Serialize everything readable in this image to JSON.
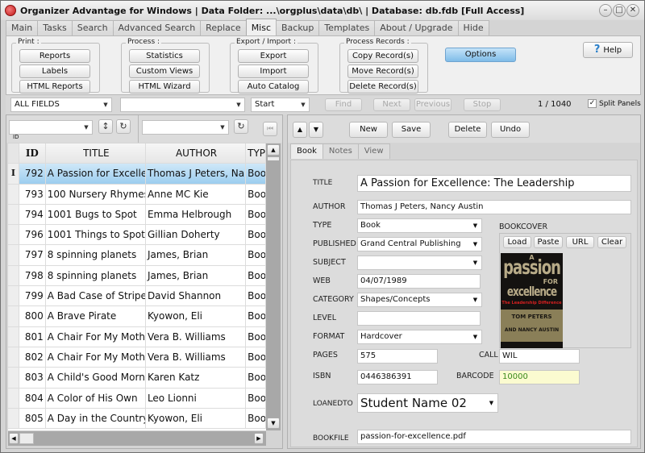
{
  "window": {
    "title": "Organizer Advantage for Windows | Data Folder: ...\\orgplus\\data\\db\\ | Database: db.fdb [Full Access]",
    "controls": [
      "–",
      "□",
      "✕"
    ]
  },
  "tabs": [
    "Main",
    "Tasks",
    "Search",
    "Advanced Search",
    "Replace",
    "Misc",
    "Backup",
    "Templates",
    "About / Upgrade",
    "Hide"
  ],
  "active_tab": "Misc",
  "ribbon": {
    "print": {
      "label": "Print :",
      "buttons": [
        "Reports",
        "Labels",
        "HTML Reports"
      ]
    },
    "process": {
      "label": "Process :",
      "buttons": [
        "Statistics",
        "Custom Views",
        "HTML Wizard"
      ]
    },
    "export": {
      "label": "Export / Import :",
      "buttons": [
        "Export",
        "Import",
        "Auto Catalog"
      ]
    },
    "records": {
      "label": "Process Records :",
      "buttons": [
        "Copy Record(s)",
        "Move Record(s)",
        "Delete Record(s)"
      ]
    },
    "options_label": "Options",
    "help_label": "Help",
    "help_icon": "?"
  },
  "search": {
    "field": "ALL FIELDS",
    "value": "",
    "mode": "Start",
    "find": "Find",
    "next": "Next",
    "previous": "Previous",
    "stop": "Stop",
    "record_count": "1 / 1040",
    "split_panels": "Split Panels",
    "split_checked": "✓"
  },
  "filter": {
    "sort_field": "",
    "sort_label": "ID",
    "filter_field": ""
  },
  "grid": {
    "columns": [
      "ID",
      "TITLE",
      "AUTHOR",
      "TYPE"
    ],
    "selected_indicator": "I",
    "rows": [
      {
        "id": "792",
        "title": "A Passion for Excelle",
        "author": "Thomas J Peters, Na",
        "type": "Book"
      },
      {
        "id": "793",
        "title": "100 Nursery Rhymes",
        "author": "Anne MC Kie",
        "type": "Book"
      },
      {
        "id": "794",
        "title": "1001 Bugs to Spot",
        "author": "Emma Helbrough",
        "type": "Book"
      },
      {
        "id": "796",
        "title": "1001 Things to Spot",
        "author": "Gillian Doherty",
        "type": "Book"
      },
      {
        "id": "797",
        "title": "8 spinning planets",
        "author": "James, Brian",
        "type": "Book"
      },
      {
        "id": "798",
        "title": "8 spinning planets",
        "author": "James, Brian",
        "type": "Book"
      },
      {
        "id": "799",
        "title": "A Bad Case of Stripe",
        "author": "David Shannon",
        "type": "Book"
      },
      {
        "id": "800",
        "title": "A Brave Pirate",
        "author": "Kyowon, Eli",
        "type": "Book"
      },
      {
        "id": "801",
        "title": "A Chair For My Moth",
        "author": "Vera B. Williams",
        "type": "Book"
      },
      {
        "id": "802",
        "title": "A Chair For My Moth",
        "author": "Vera B. Williams",
        "type": "Book"
      },
      {
        "id": "803",
        "title": "A Child's Good Morn",
        "author": "Karen Katz",
        "type": "Book"
      },
      {
        "id": "804",
        "title": "A Color of His Own",
        "author": "Leo Lionni",
        "type": "Book"
      },
      {
        "id": "805",
        "title": "A Day in the Country",
        "author": "Kyowon, Eli",
        "type": "Book"
      }
    ]
  },
  "record_toolbar": {
    "new": "New",
    "save": "Save",
    "delete": "Delete",
    "undo": "Undo"
  },
  "record_tabs": [
    "Book",
    "Notes",
    "View"
  ],
  "record": {
    "labels": {
      "title": "TITLE",
      "author": "AUTHOR",
      "type": "TYPE",
      "published": "PUBLISHED",
      "subject": "SUBJECT",
      "web": "WEB",
      "category": "CATEGORY",
      "level": "LEVEL",
      "format": "FORMAT",
      "pages": "PAGES",
      "call": "CALL",
      "isbn": "ISBN",
      "barcode": "BARCODE",
      "loanedto": "LOANEDTO",
      "bookfile": "BOOKFILE",
      "bookcover": "BOOKCOVER"
    },
    "values": {
      "title": "A Passion for Excellence: The Leadership",
      "author": "Thomas J Peters, Nancy Austin",
      "type": "Book",
      "published": "Grand Central Publishing",
      "subject": "",
      "web": "04/07/1989",
      "category": "Shapes/Concepts",
      "level": "",
      "format": "Hardcover",
      "pages": "575",
      "call": "WIL",
      "isbn": "0446386391",
      "barcode": "10000",
      "loanedto": "Student Name 02",
      "bookfile": "passion-for-excellence.pdf"
    },
    "cover_buttons": [
      "Load",
      "Paste",
      "URL",
      "Clear"
    ],
    "cover_text": {
      "a": "A",
      "line1": "passion",
      "line2": "FOR",
      "line3": "excellence",
      "line4": "The Leadership Difference",
      "line5": "TOM PETERS",
      "line6": "AND NANCY AUSTIN"
    }
  },
  "colors": {
    "selected_row": "#9ccdef",
    "options_button": "#7fbce8",
    "barcode_bg": "#fbfbd0",
    "barcode_text": "#3a8a1a"
  }
}
